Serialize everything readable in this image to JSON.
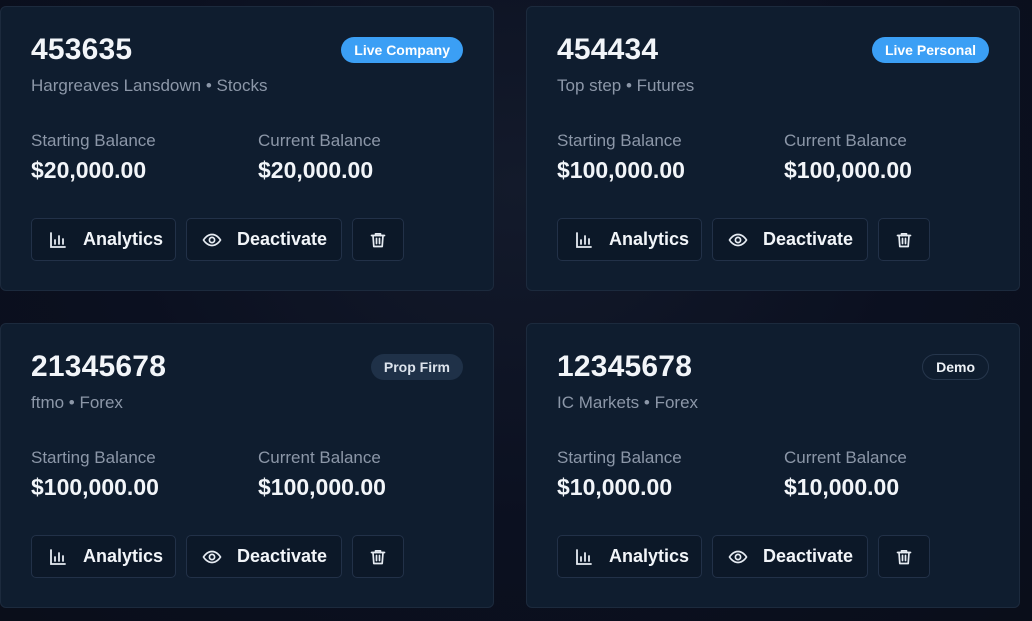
{
  "accounts": [
    {
      "number": "453635",
      "subtitle": "Hargreaves Lansdown • Stocks",
      "badge": "Live Company",
      "badge_style": "live",
      "starting_label": "Starting Balance",
      "starting_value": "$20,000.00",
      "current_label": "Current Balance",
      "current_value": "$20,000.00",
      "analytics_label": "Analytics",
      "deactivate_label": "Deactivate"
    },
    {
      "number": "454434",
      "subtitle": "Top step • Futures",
      "badge": "Live Personal",
      "badge_style": "live",
      "starting_label": "Starting Balance",
      "starting_value": "$100,000.00",
      "current_label": "Current Balance",
      "current_value": "$100,000.00",
      "analytics_label": "Analytics",
      "deactivate_label": "Deactivate"
    },
    {
      "number": "21345678",
      "subtitle": "ftmo • Forex",
      "badge": "Prop Firm",
      "badge_style": "prop",
      "starting_label": "Starting Balance",
      "starting_value": "$100,000.00",
      "current_label": "Current Balance",
      "current_value": "$100,000.00",
      "analytics_label": "Analytics",
      "deactivate_label": "Deactivate"
    },
    {
      "number": "12345678",
      "subtitle": "IC Markets • Forex",
      "badge": "Demo",
      "badge_style": "demo",
      "starting_label": "Starting Balance",
      "starting_value": "$10,000.00",
      "current_label": "Current Balance",
      "current_value": "$10,000.00",
      "analytics_label": "Analytics",
      "deactivate_label": "Deactivate"
    }
  ],
  "icons": {
    "analytics": "bar-chart-icon",
    "deactivate": "eye-icon",
    "delete": "trash-icon"
  },
  "colors": {
    "live_badge": "#3b9ff5",
    "prop_badge": "#1f3148",
    "card_bg": "#0f1d2f"
  }
}
